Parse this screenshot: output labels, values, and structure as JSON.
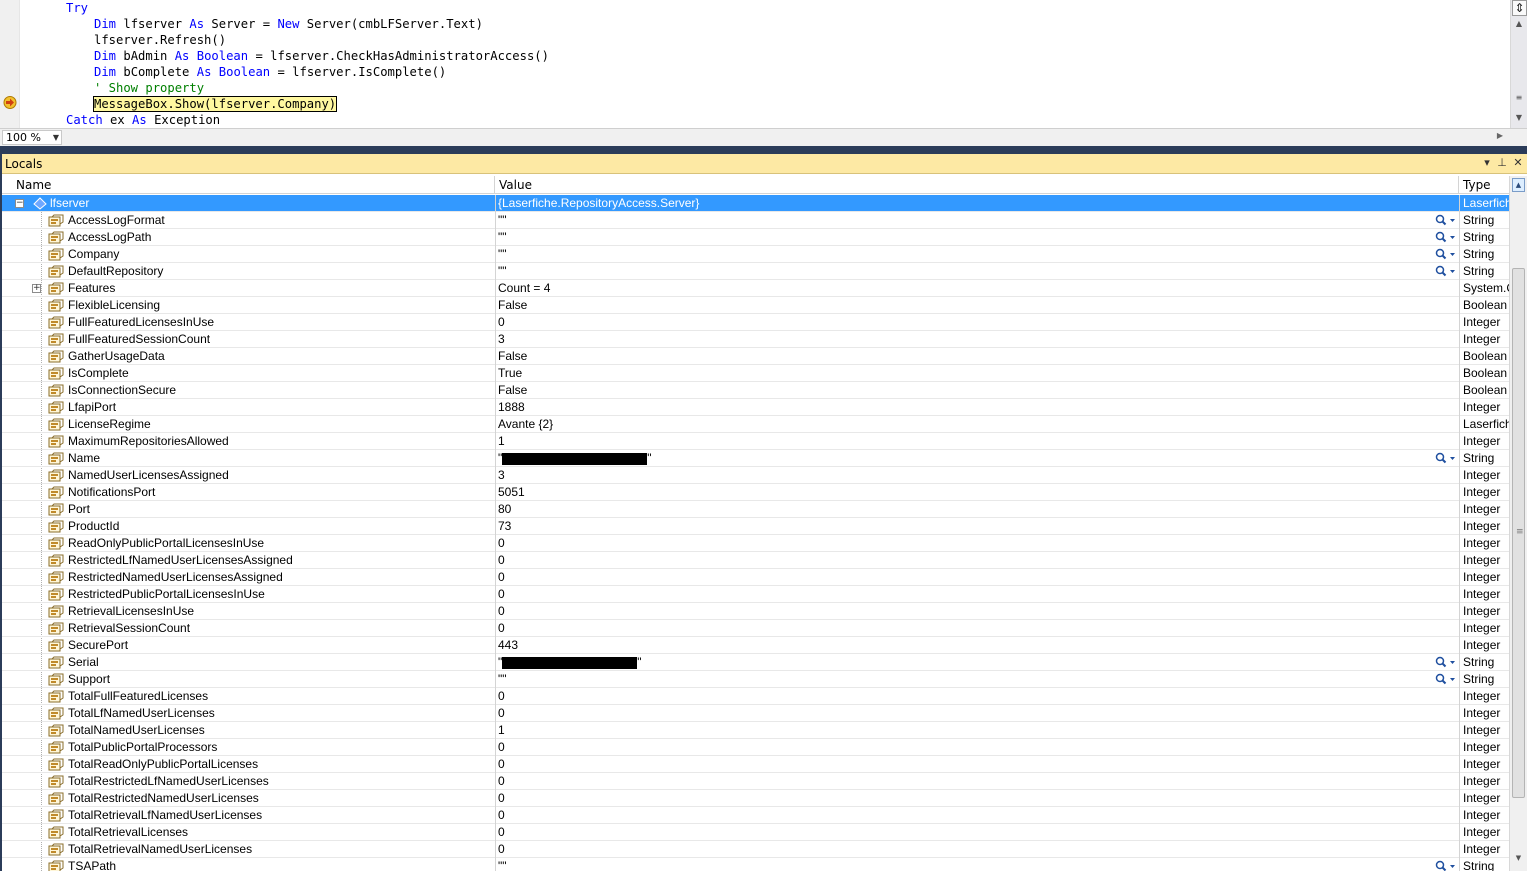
{
  "editor": {
    "code": [
      {
        "indent": 3,
        "tokens": [
          {
            "t": "Try",
            "c": "kw"
          }
        ]
      },
      {
        "indent": 4,
        "tokens": [
          {
            "t": "Dim",
            "c": "kw"
          },
          {
            "t": " lfserver "
          },
          {
            "t": "As",
            "c": "kw"
          },
          {
            "t": " Server = "
          },
          {
            "t": "New",
            "c": "kw"
          },
          {
            "t": " Server(cmbLFServer.Text)"
          }
        ]
      },
      {
        "indent": 4,
        "tokens": [
          {
            "t": "lfserver.Refresh()"
          }
        ]
      },
      {
        "indent": 4,
        "tokens": [
          {
            "t": "Dim",
            "c": "kw"
          },
          {
            "t": " bAdmin "
          },
          {
            "t": "As",
            "c": "kw"
          },
          {
            "t": " "
          },
          {
            "t": "Boolean",
            "c": "kw"
          },
          {
            "t": " = lfserver.CheckHasAdministratorAccess()"
          }
        ]
      },
      {
        "indent": 4,
        "tokens": [
          {
            "t": "Dim",
            "c": "kw"
          },
          {
            "t": " bComplete "
          },
          {
            "t": "As",
            "c": "kw"
          },
          {
            "t": " "
          },
          {
            "t": "Boolean",
            "c": "kw"
          },
          {
            "t": " = lfserver.IsComplete()"
          }
        ]
      },
      {
        "indent": 4,
        "tokens": [
          {
            "t": "' Show property",
            "c": "cm"
          }
        ]
      },
      {
        "indent": 4,
        "tokens": [
          {
            "t": "MessageBox.Show(lfserver.Company)",
            "c": "hl"
          }
        ]
      },
      {
        "indent": 3,
        "tokens": [
          {
            "t": "Catch",
            "c": "kw"
          },
          {
            "t": " ex "
          },
          {
            "t": "As",
            "c": "kw"
          },
          {
            "t": " Exception"
          }
        ]
      }
    ],
    "zoom": "100 %",
    "breakpoint_icon": "current-statement-arrow-icon",
    "split_icon": "split-window-icon"
  },
  "locals": {
    "title": "Locals",
    "columns": {
      "name": "Name",
      "value": "Value",
      "type": "Type"
    },
    "title_buttons": [
      "dropdown-arrow-icon",
      "pin-icon",
      "close-icon"
    ],
    "rows": [
      {
        "name": "lfserver",
        "value": "{Laserfiche.RepositoryAccess.Server}",
        "type": "Laserfich",
        "root": true,
        "expander": "minus"
      },
      {
        "name": "AccessLogFormat",
        "value": "\"\"",
        "type": "String",
        "mag": true
      },
      {
        "name": "AccessLogPath",
        "value": "\"\"",
        "type": "String",
        "mag": true
      },
      {
        "name": "Company",
        "value": "\"\"",
        "type": "String",
        "mag": true
      },
      {
        "name": "DefaultRepository",
        "value": "\"\"",
        "type": "String",
        "mag": true
      },
      {
        "name": "Features",
        "value": "Count = 4",
        "type": "System.C",
        "expander": "plus"
      },
      {
        "name": "FlexibleLicensing",
        "value": "False",
        "type": "Boolean"
      },
      {
        "name": "FullFeaturedLicensesInUse",
        "value": "0",
        "type": "Integer"
      },
      {
        "name": "FullFeaturedSessionCount",
        "value": "3",
        "type": "Integer"
      },
      {
        "name": "GatherUsageData",
        "value": "False",
        "type": "Boolean"
      },
      {
        "name": "IsComplete",
        "value": "True",
        "type": "Boolean"
      },
      {
        "name": "IsConnectionSecure",
        "value": "False",
        "type": "Boolean"
      },
      {
        "name": "LfapiPort",
        "value": "1888",
        "type": "Integer"
      },
      {
        "name": "LicenseRegime",
        "value": "Avante {2}",
        "type": "Laserfich"
      },
      {
        "name": "MaximumRepositoriesAllowed",
        "value": "1",
        "type": "Integer"
      },
      {
        "name": "Name",
        "value": "\"",
        "value_end": "\"",
        "type": "String",
        "mag": true,
        "redacted": true
      },
      {
        "name": "NamedUserLicensesAssigned",
        "value": "3",
        "type": "Integer"
      },
      {
        "name": "NotificationsPort",
        "value": "5051",
        "type": "Integer"
      },
      {
        "name": "Port",
        "value": "80",
        "type": "Integer"
      },
      {
        "name": "ProductId",
        "value": "73",
        "type": "Integer"
      },
      {
        "name": "ReadOnlyPublicPortalLicensesInUse",
        "value": "0",
        "type": "Integer"
      },
      {
        "name": "RestrictedLfNamedUserLicensesAssigned",
        "value": "0",
        "type": "Integer"
      },
      {
        "name": "RestrictedNamedUserLicensesAssigned",
        "value": "0",
        "type": "Integer"
      },
      {
        "name": "RestrictedPublicPortalLicensesInUse",
        "value": "0",
        "type": "Integer"
      },
      {
        "name": "RetrievalLicensesInUse",
        "value": "0",
        "type": "Integer"
      },
      {
        "name": "RetrievalSessionCount",
        "value": "0",
        "type": "Integer"
      },
      {
        "name": "SecurePort",
        "value": "443",
        "type": "Integer"
      },
      {
        "name": "Serial",
        "value": "\"",
        "value_end": "\"",
        "type": "String",
        "mag": true,
        "redacted": true
      },
      {
        "name": "Support",
        "value": "\"\"",
        "type": "String",
        "mag": true
      },
      {
        "name": "TotalFullFeaturedLicenses",
        "value": "0",
        "type": "Integer"
      },
      {
        "name": "TotalLfNamedUserLicenses",
        "value": "0",
        "type": "Integer"
      },
      {
        "name": "TotalNamedUserLicenses",
        "value": "1",
        "type": "Integer"
      },
      {
        "name": "TotalPublicPortalProcessors",
        "value": "0",
        "type": "Integer"
      },
      {
        "name": "TotalReadOnlyPublicPortalLicenses",
        "value": "0",
        "type": "Integer"
      },
      {
        "name": "TotalRestrictedLfNamedUserLicenses",
        "value": "0",
        "type": "Integer"
      },
      {
        "name": "TotalRestrictedNamedUserLicenses",
        "value": "0",
        "type": "Integer"
      },
      {
        "name": "TotalRetrievalLfNamedUserLicenses",
        "value": "0",
        "type": "Integer"
      },
      {
        "name": "TotalRetrievalLicenses",
        "value": "0",
        "type": "Integer"
      },
      {
        "name": "TotalRetrievalNamedUserLicenses",
        "value": "0",
        "type": "Integer"
      },
      {
        "name": "TSAPath",
        "value": "\"\"",
        "type": "String",
        "mag": true
      }
    ]
  },
  "colors": {
    "keyword": "#0000ff",
    "comment": "#008000",
    "selected_row": "#3399ff",
    "tool_title": "#fde9a4",
    "frame": "#2b3c59"
  }
}
